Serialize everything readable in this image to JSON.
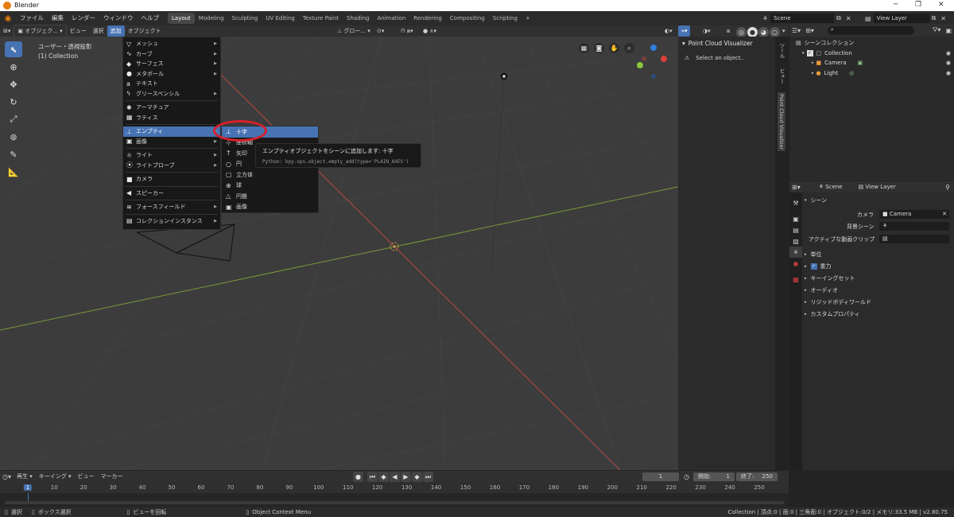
{
  "app": {
    "title": "Blender",
    "accent": "#4772b3",
    "highlight_circle_color": "#d8202a"
  },
  "menubar": {
    "menus": [
      "ファイル",
      "編集",
      "レンダー",
      "ウィンドウ",
      "ヘルプ"
    ],
    "workspaces": [
      "Layout",
      "Modeling",
      "Sculpting",
      "UV Editing",
      "Texture Paint",
      "Shading",
      "Animation",
      "Rendering",
      "Compositing",
      "Scripting"
    ],
    "add_workspace": "+",
    "scene": "Scene",
    "view_layer": "View Layer"
  },
  "viewport_header": {
    "mode": "オブジェク...",
    "menus": [
      "ビュー",
      "選択",
      "追加",
      "オブジェクト"
    ],
    "transform": "グロー..."
  },
  "viewport": {
    "overlay_line1": "ユーザー・透視投影",
    "overlay_line2": "(1) Collection"
  },
  "add_menu": {
    "items": [
      {
        "icon": "▽",
        "icon_name": "mesh-icon",
        "label": "メッシュ",
        "submenu": true
      },
      {
        "icon": "∿",
        "icon_name": "curve-icon",
        "label": "カーブ",
        "submenu": true
      },
      {
        "icon": "◆",
        "icon_name": "surface-icon",
        "label": "サーフェス",
        "submenu": true
      },
      {
        "icon": "●",
        "icon_name": "metaball-icon",
        "label": "メタボール",
        "submenu": true
      },
      {
        "icon": "a",
        "icon_name": "text-icon",
        "label": "テキスト",
        "submenu": false
      },
      {
        "icon": "ϟ",
        "icon_name": "grease-pencil-icon",
        "label": "グリースペンシル",
        "submenu": true
      },
      {
        "icon": "✱",
        "icon_name": "armature-icon",
        "label": "アーマチュア",
        "submenu": false
      },
      {
        "icon": "▦",
        "icon_name": "lattice-icon",
        "label": "ラティス",
        "submenu": false
      },
      {
        "icon": "⊥",
        "icon_name": "empty-icon",
        "label": "エンプティ",
        "submenu": true
      },
      {
        "icon": "▣",
        "icon_name": "image-icon",
        "label": "画像",
        "submenu": true
      },
      {
        "icon": "☼",
        "icon_name": "light-icon",
        "label": "ライト",
        "submenu": true
      },
      {
        "icon": "⦿",
        "icon_name": "light-probe-icon",
        "label": "ライトプローブ",
        "submenu": true
      },
      {
        "icon": "■",
        "icon_name": "camera-icon",
        "label": "カメラ",
        "submenu": false
      },
      {
        "icon": "◀",
        "icon_name": "speaker-icon",
        "label": "スピーカー",
        "submenu": false
      },
      {
        "icon": "≋",
        "icon_name": "force-field-icon",
        "label": "フォースフィールド",
        "submenu": true
      },
      {
        "icon": "▤",
        "icon_name": "collection-instance-icon",
        "label": "コレクションインスタンス",
        "submenu": true
      }
    ]
  },
  "empty_submenu": {
    "items": [
      {
        "icon": "⊥",
        "icon_name": "plain-axes-icon",
        "label": "十字"
      },
      {
        "icon": "⊹",
        "icon_name": "arrows-icon",
        "label": "座標軸"
      },
      {
        "icon": "↑",
        "icon_name": "single-arrow-icon",
        "label": "矢印"
      },
      {
        "icon": "○",
        "icon_name": "circle-icon",
        "label": "円"
      },
      {
        "icon": "▢",
        "icon_name": "cube-icon",
        "label": "立方体"
      },
      {
        "icon": "⊕",
        "icon_name": "sphere-icon",
        "label": "球"
      },
      {
        "icon": "△",
        "icon_name": "cone-icon",
        "label": "円錐"
      },
      {
        "icon": "▣",
        "icon_name": "image-icon",
        "label": "画像"
      }
    ]
  },
  "tooltip": {
    "text": "エンプティオブジェクトをシーンに追加します: 十字",
    "python": "Python: bpy.ops.object.empty_add(type='PLAIN_AXES')"
  },
  "npanel": {
    "title": "Point Cloud Visualizer",
    "message": "Select an object..",
    "tabs": [
      "ツール",
      "ビュー",
      "Point Cloud Visualizer"
    ]
  },
  "outliner": {
    "root": "シーンコレクション",
    "items": [
      {
        "label": "Collection",
        "indent": 1
      },
      {
        "label": "Camera",
        "indent": 2
      },
      {
        "label": "Light",
        "indent": 2
      }
    ]
  },
  "properties": {
    "breadcrumb_scene": "Scene",
    "breadcrumb_view_layer": "View Layer",
    "section": "シーン",
    "camera_label": "カメラ",
    "camera_value": "Camera",
    "background_label": "背景シーン",
    "active_clip_label": "アクティブな動画クリップ",
    "panels": [
      "単位",
      "重力",
      "キーイングセット",
      "オーディオ",
      "リジッドボディワールド",
      "カスタムプロパティ"
    ]
  },
  "timeline": {
    "menus": [
      "再生",
      "キーイング",
      "ビュー",
      "マーカー"
    ],
    "current_frame": "1",
    "start_label": "開始:",
    "start": "1",
    "end_label": "終了:",
    "end": "250",
    "ticks": [
      "1",
      "10",
      "20",
      "30",
      "40",
      "50",
      "60",
      "70",
      "80",
      "90",
      "100",
      "110",
      "120",
      "130",
      "140",
      "150",
      "160",
      "170",
      "180",
      "190",
      "200",
      "210",
      "220",
      "230",
      "240",
      "250"
    ]
  },
  "statusbar": {
    "select": "選択",
    "box_select": "ボックス選択",
    "rotate_view": "ビューを回転",
    "context_menu": "Object Context Menu",
    "stats": "Collection | 頂点:0 | 面:0 | 三角面:0 | オブジェクト:0/2 | メモリ:33.5 MB | v2.80.75"
  }
}
